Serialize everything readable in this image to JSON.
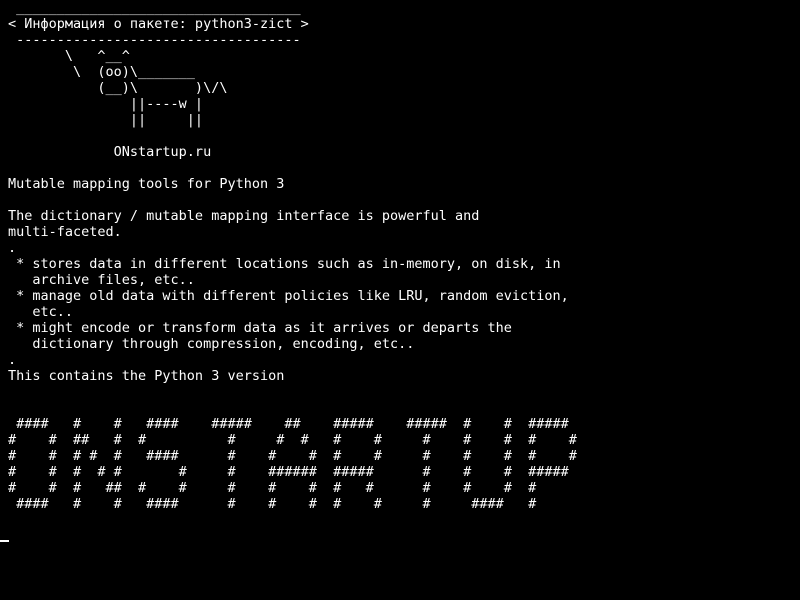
{
  "terminal": {
    "foreground": "#ffffff",
    "background": "#000000",
    "lines": [
      " ___________________________________",
      "< Информация о пакете: python3-zict >",
      " -----------------------------------",
      "       \\   ^__^",
      "        \\  (oo)\\_______",
      "           (__)\\       )\\/\\",
      "               ||----w |",
      "               ||     ||",
      "",
      "             ONstartup.ru",
      "",
      "Mutable mapping tools for Python 3",
      "",
      "The dictionary / mutable mapping interface is powerful and",
      "multi-faceted.",
      ".",
      " * stores data in different locations such as in-memory, on disk, in",
      "   archive files, etc..",
      " * manage old data with different policies like LRU, random eviction,",
      "   etc..",
      " * might encode or transform data as it arrives or departs the",
      "   dictionary through compression, encoding, etc..",
      ".",
      "This contains the Python 3 version",
      "",
      "",
      " ####   #    #   ####    #####    ##    #####    #####  #    #  #####",
      "#    #  ##   #  #          #     #  #   #    #     #    #    #  #    #",
      "#    #  # #  #   ####      #    #    #  #    #     #    #    #  #    #",
      "#    #  #  # #       #     #    ######  #####      #    #    #  #####",
      "#    #  #   ##  #    #     #    #    #  #   #      #    #    #  #",
      " ####   #    #   ####      #    #    #  #    #     #     ####   #"
    ]
  }
}
